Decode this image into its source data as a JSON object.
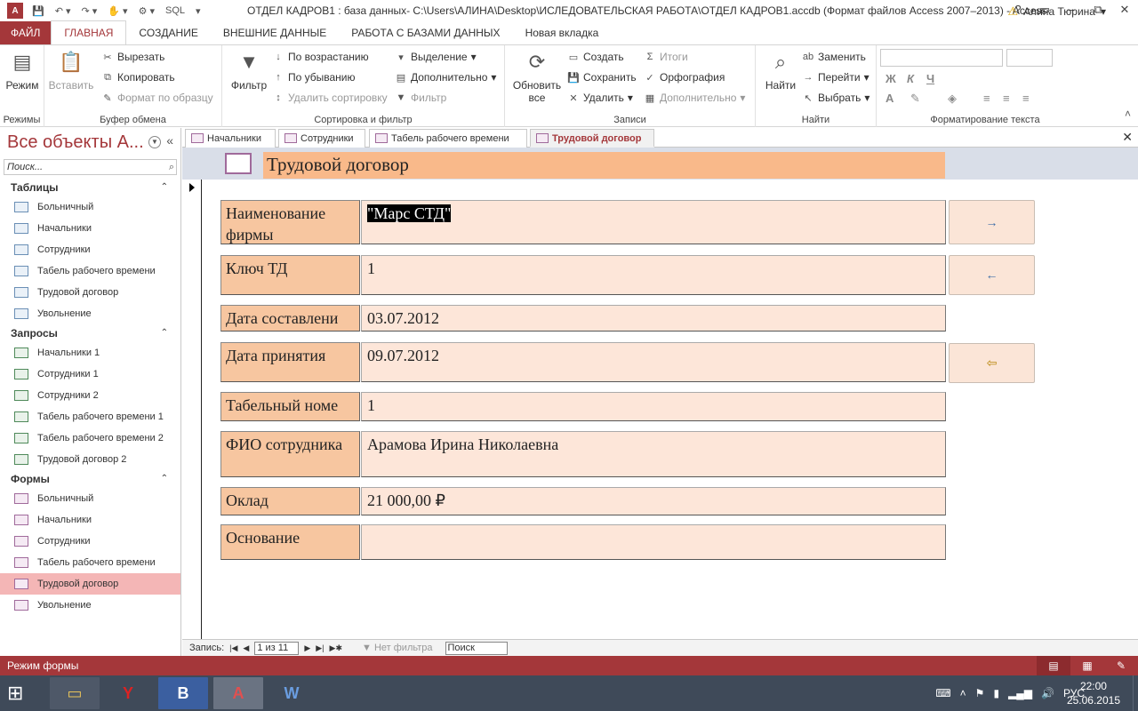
{
  "window": {
    "title": "ОТДЕЛ КАДРОВ1 : база данных- C:\\Users\\АЛИНА\\Desktop\\ИСЛЕДОВАТЕЛЬСКАЯ РАБОТА\\ОТДЕЛ КАДРОВ1.accdb (Формат файлов Access 2007–2013) - Access",
    "app_icon": "A",
    "qat_sql": "SQL",
    "controls": [
      "?",
      "▭",
      "–",
      "⧉",
      "✕"
    ]
  },
  "ribbon_tabs": [
    "ФАЙЛ",
    "ГЛАВНАЯ",
    "СОЗДАНИЕ",
    "ВНЕШНИЕ ДАННЫЕ",
    "РАБОТА С БАЗАМИ ДАННЫХ",
    "Новая вкладка"
  ],
  "user": "Алина Тюрина",
  "ribbon": {
    "views": {
      "label": "Режимы",
      "mode": "Режим"
    },
    "clipboard": {
      "label": "Буфер обмена",
      "paste": "Вставить",
      "cut": "Вырезать",
      "copy": "Копировать",
      "format_painter": "Формат по образцу"
    },
    "sort": {
      "label": "Сортировка и фильтр",
      "filter": "Фильтр",
      "asc": "По возрастанию",
      "desc": "По убыванию",
      "remove_sort": "Удалить сортировку",
      "selection": "Выделение",
      "advanced": "Дополнительно",
      "toggle_filter": "Фильтр"
    },
    "records": {
      "label": "Записи",
      "refresh": "Обновить все",
      "new": "Создать",
      "save": "Сохранить",
      "delete": "Удалить",
      "totals": "Итоги",
      "spelling": "Орфография",
      "more": "Дополнительно"
    },
    "find": {
      "label": "Найти",
      "find": "Найти",
      "replace": "Заменить",
      "goto": "Перейти",
      "select": "Выбрать"
    },
    "text_format": {
      "label": "Форматирование текста",
      "bold": "Ж",
      "italic": "К",
      "underline": "Ч",
      "font_color": "A"
    }
  },
  "nav": {
    "title": "Все объекты А...",
    "search_placeholder": "Поиск...",
    "sections": [
      {
        "name": "Таблицы",
        "items": [
          "Больничный",
          "Начальники",
          "Сотрудники",
          "Табель рабочего времени",
          "Трудовой договор",
          "Увольнение"
        ]
      },
      {
        "name": "Запросы",
        "items": [
          "Начальники 1",
          "Сотрудники 1",
          "Сотрудники 2",
          "Табель рабочего времени 1",
          "Табель рабочего времени 2",
          "Трудовой договор 2"
        ]
      },
      {
        "name": "Формы",
        "items": [
          "Больничный",
          "Начальники",
          "Сотрудники",
          "Табель рабочего времени",
          "Трудовой договор",
          "Увольнение"
        ]
      }
    ]
  },
  "doc_tabs": [
    "Начальники",
    "Сотрудники",
    "Табель рабочего времени",
    "Трудовой договор"
  ],
  "form": {
    "title": "Трудовой договор",
    "fields": [
      {
        "label": "Наименование фирмы",
        "value": "\"Марс СТД\""
      },
      {
        "label": "Ключ ТД",
        "value": "1"
      },
      {
        "label": "Дата составлени",
        "value": "03.07.2012"
      },
      {
        "label": "Дата принятия",
        "value": "09.07.2012"
      },
      {
        "label": "Табельный номе",
        "value": "1"
      },
      {
        "label": "ФИО сотрудника",
        "value": "Арамова Ирина Николаевна"
      },
      {
        "label": "Оклад",
        "value": "21 000,00 ₽"
      },
      {
        "label": "Основание",
        "value": ""
      }
    ],
    "buttons": {
      "next": "→",
      "prev": "←",
      "exit": "⇦"
    }
  },
  "record_bar": {
    "label": "Запись:",
    "position": "1 из 11",
    "filter": "Нет фильтра",
    "search": "Поиск"
  },
  "status": {
    "text": "Режим формы"
  },
  "taskbar": {
    "language": "РУС",
    "time": "22:00",
    "date": "25.06.2015"
  }
}
